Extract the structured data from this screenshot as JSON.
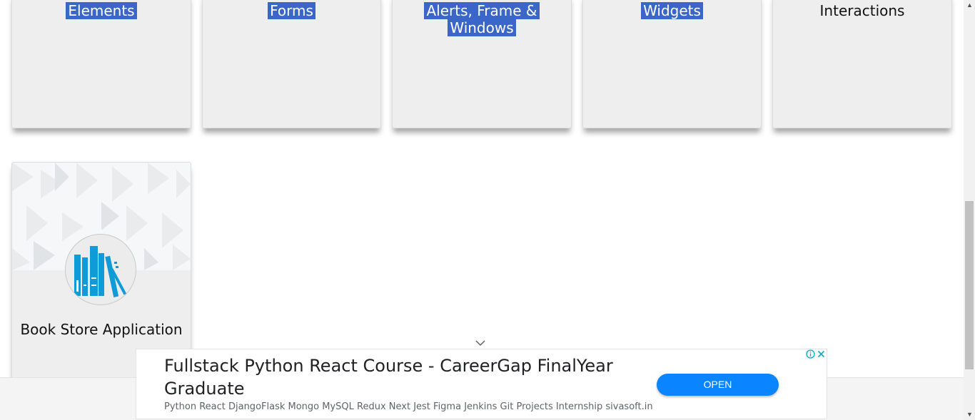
{
  "cards_row1": [
    {
      "title_line1": "Elements",
      "title_line2": "",
      "highlighted": true
    },
    {
      "title_line1": "Forms",
      "title_line2": "",
      "highlighted": true
    },
    {
      "title_line1": "Alerts, Frame &",
      "title_line2": "Windows",
      "highlighted": true
    },
    {
      "title_line1": "Widgets",
      "title_line2": "",
      "highlighted": true
    },
    {
      "title_line1": "Interactions",
      "title_line2": "",
      "highlighted": false
    }
  ],
  "book_card": {
    "title": "Book Store Application",
    "icon": "books-icon"
  },
  "ad": {
    "headline": "Fullstack Python React Course - CareerGap FinalYear Graduate",
    "description": "Python React DjangoFlask Mongo MySQL Redux Next Jest Figma Jenkins Git Projects Internship sivasoft.in",
    "button_label": "OPEN",
    "info_icon": "info-icon",
    "close_icon": "close-icon",
    "collapse_icon": "chevron-down-icon",
    "button_color": "#0a84ff"
  },
  "colors": {
    "highlight": "#3a66c8",
    "card_bg": "#eeeeee",
    "book_icon": "#0f9bd7"
  }
}
